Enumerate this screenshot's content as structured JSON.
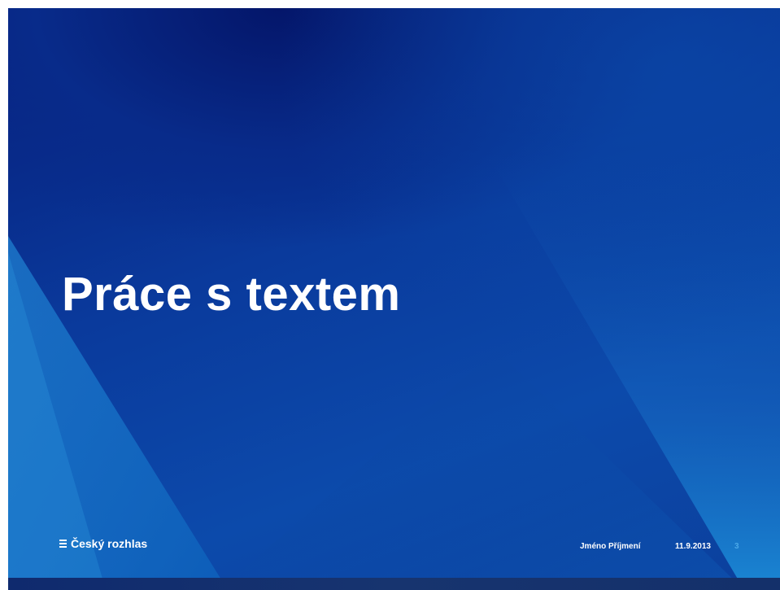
{
  "slide": {
    "title": "Práce s textem",
    "logo_text": "Český rozhlas",
    "logo_icon": "cesky-rozhlas-logo-mark",
    "footer": {
      "author": "Jméno Příjmení",
      "date": "11.9.2013",
      "page_number": "3"
    }
  },
  "colors": {
    "background_dark": "#061d7a",
    "background_mid": "#0a3a9c",
    "background_light": "#1b8ad6",
    "text": "#ffffff",
    "page_number": "#4aa8e8"
  }
}
